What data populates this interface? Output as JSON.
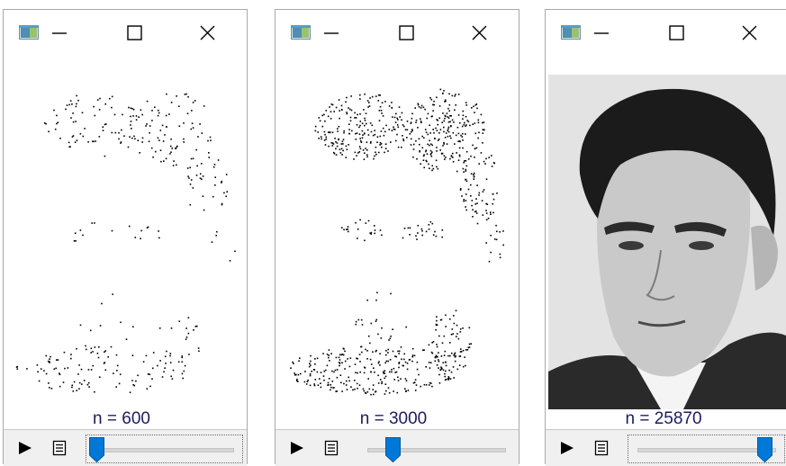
{
  "windows": [
    {
      "count_label": "n = 600",
      "slider_fraction": 0.0,
      "render": "sparse",
      "density": 0.2
    },
    {
      "count_label": "n = 3000",
      "slider_fraction": 0.19,
      "render": "dense",
      "density": 0.55
    },
    {
      "count_label": "n = 25870",
      "slider_fraction": 1.0,
      "render": "photo",
      "density": 1.0
    }
  ],
  "icons": {
    "app": "app-window-icon",
    "minimize": "minimize-icon",
    "maximize": "maximize-icon",
    "close": "close-icon",
    "play": "play-icon",
    "document": "document-icon"
  },
  "colors": {
    "slider_thumb": "#0078d7",
    "count_text": "#1c1c5e",
    "toolbar_bg": "#f0f0f0",
    "photo_bg": "#e3e3e3",
    "hair": "#1b1b1b"
  }
}
